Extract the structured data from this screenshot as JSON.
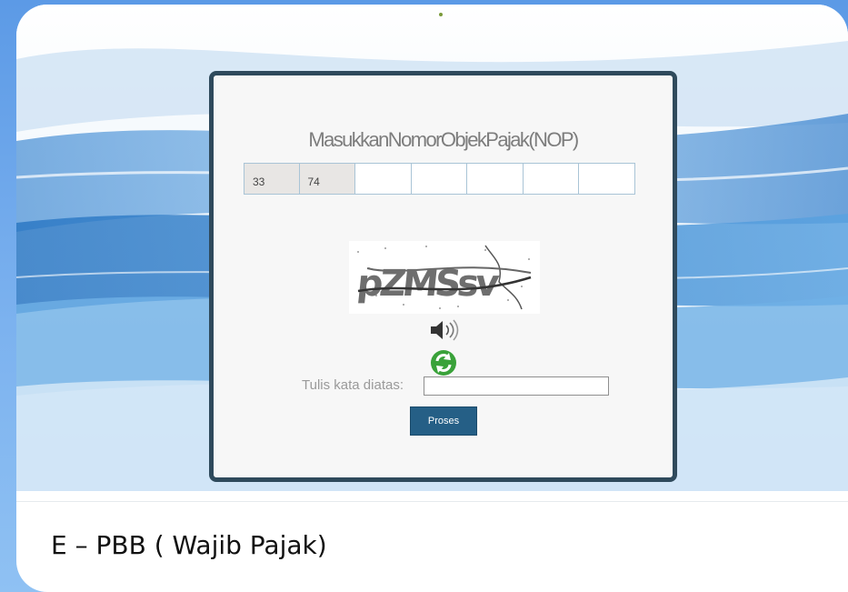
{
  "form": {
    "title": "MasukkanNomorObjekPajak(NOP)",
    "nop_fields": [
      "33",
      "74",
      "",
      "",
      "",
      "",
      ""
    ],
    "captcha_text": "pZMSsv",
    "captcha_label": "Tulis kata diatas:",
    "captcha_value": "",
    "submit_label": "Proses"
  },
  "slide": {
    "caption": "E – PBB ( Wajib Pajak)"
  },
  "icons": {
    "audio": "speaker-icon",
    "refresh": "refresh-icon"
  },
  "colors": {
    "panel_border": "#2f4a5c",
    "button": "#255f86",
    "refresh_green": "#3aa23a"
  }
}
